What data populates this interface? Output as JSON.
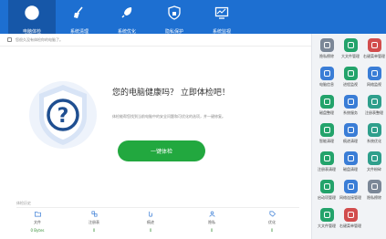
{
  "tabs": [
    {
      "label": "电脑体检",
      "icon": "checkup-icon",
      "active": true
    },
    {
      "label": "系统清理",
      "icon": "broom-icon",
      "active": false
    },
    {
      "label": "系统优化",
      "icon": "rocket-icon",
      "active": false
    },
    {
      "label": "隐私保护",
      "icon": "shield-lock-icon",
      "active": false
    },
    {
      "label": "系统监视",
      "icon": "monitor-icon",
      "active": false
    }
  ],
  "tip": "您很久没有体检你的电脑了。",
  "main": {
    "title": "您的电脑健康吗？ 立即体检吧！",
    "subtitle": "体检能帮您找到当前电脑中的安全问题和可优化的选项，并一键修复。",
    "button": "一键体检",
    "stats_title": "体检历史"
  },
  "stats": [
    {
      "label": "文件",
      "value": "0 Bytes",
      "icon": "folder-icon"
    },
    {
      "label": "注册表",
      "value": "0",
      "icon": "registry-icon"
    },
    {
      "label": "痕迹",
      "value": "0",
      "icon": "footprint-icon"
    },
    {
      "label": "隐私",
      "value": "0",
      "icon": "user-icon"
    },
    {
      "label": "优化",
      "value": "0",
      "icon": "tag-icon"
    }
  ],
  "tools": [
    {
      "label": "隐私擦除",
      "color": "#7b8797",
      "icon": "eraser-icon"
    },
    {
      "label": "大文件管理",
      "color": "#23a36b",
      "icon": "bigfile-icon"
    },
    {
      "label": "右键菜单管理",
      "color": "#d24d4d",
      "icon": "rightmenu-icon"
    },
    {
      "label": "电脑信息",
      "color": "#3a7dd6",
      "icon": "pc-info-icon"
    },
    {
      "label": "进程监视",
      "color": "#23a36b",
      "icon": "process-icon"
    },
    {
      "label": "网络监视",
      "color": "#3a7dd6",
      "icon": "network-icon"
    },
    {
      "label": "磁盘整理",
      "color": "#23a36b",
      "icon": "defrag-icon"
    },
    {
      "label": "系统服务",
      "color": "#3a7dd6",
      "icon": "service-icon"
    },
    {
      "label": "注册表整理",
      "color": "#2f9f8c",
      "icon": "regedit-icon"
    },
    {
      "label": "智能清理",
      "color": "#23a36b",
      "icon": "smart-clean-icon"
    },
    {
      "label": "痕迹清理",
      "color": "#3a7dd6",
      "icon": "trace-clean-icon"
    },
    {
      "label": "系统优化",
      "color": "#2f9f8c",
      "icon": "optimize-icon"
    },
    {
      "label": "注册表清理",
      "color": "#23a36b",
      "icon": "reg-clean-icon"
    },
    {
      "label": "磁盘清理",
      "color": "#3a7dd6",
      "icon": "disk-clean-icon"
    },
    {
      "label": "文件粉碎",
      "color": "#2f9f8c",
      "icon": "shredder-icon"
    },
    {
      "label": "启动项管理",
      "color": "#23a36b",
      "icon": "startup-icon"
    },
    {
      "label": "网络连接管理",
      "color": "#3a7dd6",
      "icon": "netconn-icon"
    },
    {
      "label": "隐私擦除",
      "color": "#7b8797",
      "icon": "privacy-icon"
    },
    {
      "label": "大文件管理",
      "color": "#23a36b",
      "icon": "bigfile2-icon"
    },
    {
      "label": "右键菜单管理",
      "color": "#d24d4d",
      "icon": "rightmenu2-icon"
    }
  ]
}
